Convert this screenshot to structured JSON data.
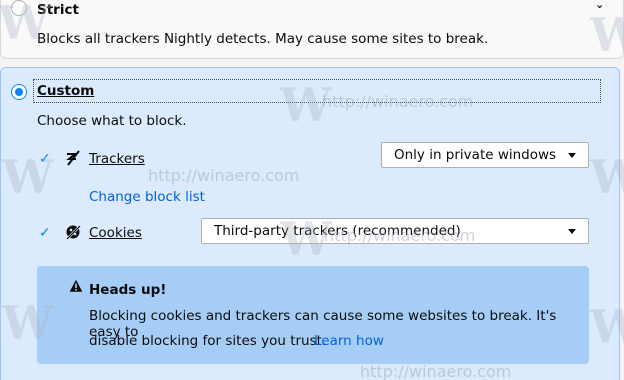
{
  "strict": {
    "title": "Strict",
    "description": "Blocks all trackers Nightly detects. May cause some sites to break."
  },
  "custom": {
    "title": "Custom",
    "choose_text": "Choose what to block.",
    "trackers": {
      "checked": true,
      "label": "Trackers",
      "dropdown_value": "Only in private windows",
      "change_link": "Change block list"
    },
    "cookies": {
      "checked": true,
      "label": "Cookies",
      "dropdown_value": "Third-party trackers (recommended)"
    }
  },
  "heads_up": {
    "title": "Heads up!",
    "line1": "Blocking cookies and trackers can cause some websites to break. It's easy to",
    "line2": "disable blocking for sites you trust.",
    "learn_link": "Learn how"
  },
  "watermark": {
    "url_text": "http://winaero.com",
    "logo_text": "W"
  },
  "colors": {
    "accent": "#0a84ff",
    "link": "#0060df",
    "custom_bg": "#dbeafd",
    "headsup_bg": "#a6cdf6"
  }
}
